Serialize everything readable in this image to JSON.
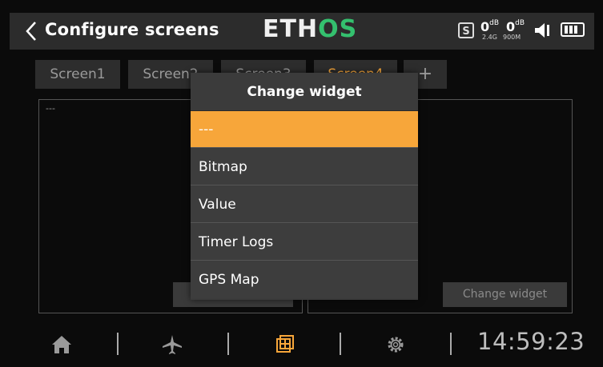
{
  "header": {
    "title": "Configure screens",
    "brand_part1": "ETH",
    "brand_part2": "OS",
    "status": {
      "s_label": "S",
      "rssi1_value": "0",
      "rssi1_unit": "dB",
      "rssi2_value": "0",
      "rssi2_unit": "dB",
      "band1": "2.4G",
      "band2": "900M"
    }
  },
  "tabs": [
    {
      "label": "Screen1"
    },
    {
      "label": "Screen2"
    },
    {
      "label": "Screen3"
    },
    {
      "label": "Screen4"
    },
    {
      "label": "+"
    }
  ],
  "panels": {
    "left_placeholder": "---",
    "change_widget_label": "Change widget"
  },
  "modal": {
    "title": "Change widget",
    "options": [
      {
        "label": "---"
      },
      {
        "label": "Bitmap"
      },
      {
        "label": "Value"
      },
      {
        "label": "Timer Logs"
      },
      {
        "label": "GPS Map"
      }
    ]
  },
  "footer": {
    "time": "14:59:23"
  },
  "colors": {
    "accent": "#f7a63a",
    "brand_green": "#34c06e",
    "background": "#0b0b0b"
  },
  "icons": [
    "back-arrow-icon",
    "home-icon",
    "airplane-icon",
    "screens-icon",
    "gear-icon"
  ]
}
